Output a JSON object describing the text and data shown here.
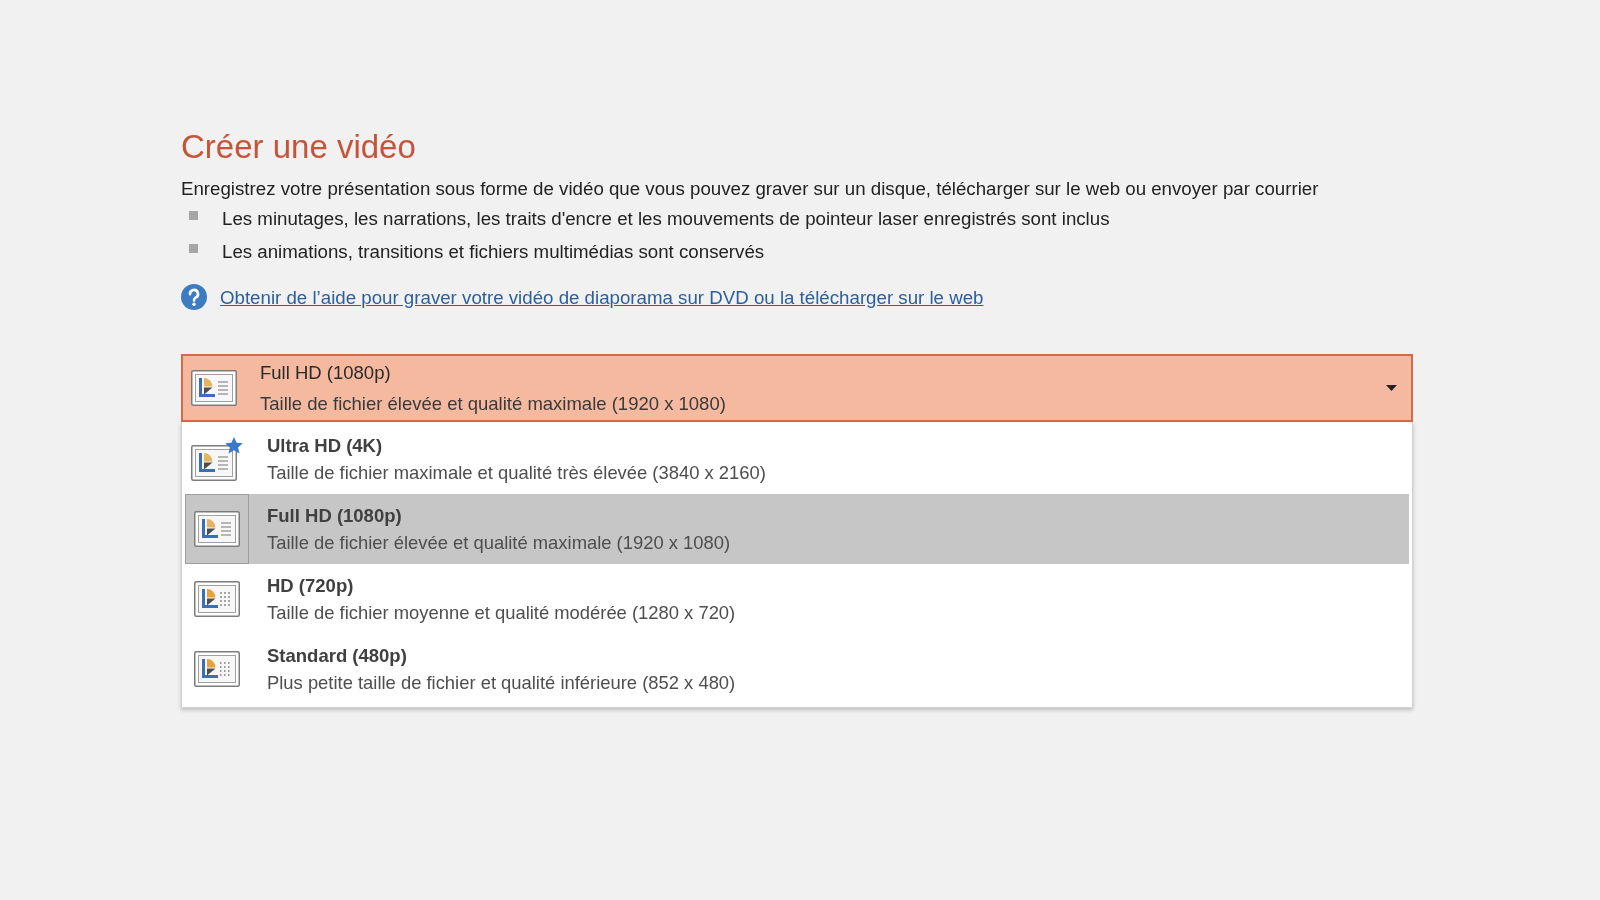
{
  "title": "Créer une vidéo",
  "description": "Enregistrez votre présentation sous forme de vidéo que vous pouvez graver sur un disque, télécharger sur le web ou envoyer par courrier",
  "bullets": [
    "Les minutages, les narrations, les traits d'encre et les mouvements de pointeur laser enregistrés sont inclus",
    "Les animations, transitions et fichiers multimédias sont conservés"
  ],
  "help_link": "Obtenir de l’aide pour graver votre vidéo de diaporama sur DVD ou la télécharger sur le web",
  "quality_dropdown": {
    "expanded": true,
    "value": {
      "kind": "full-hd",
      "title": "Full HD (1080p)",
      "subtitle": "Taille de fichier élevée et qualité maximale (1920 x 1080)"
    },
    "options": [
      {
        "kind": "ultra-hd",
        "title": "Ultra HD (4K)",
        "subtitle": "Taille de fichier maximale et qualité très élevée (3840 x 2160)",
        "selected": false
      },
      {
        "kind": "full-hd",
        "title": "Full HD (1080p)",
        "subtitle": "Taille de fichier élevée et qualité maximale (1920 x 1080)",
        "selected": true
      },
      {
        "kind": "hd",
        "title": "HD (720p)",
        "subtitle": "Taille de fichier moyenne et qualité modérée (1280 x 720)",
        "selected": false
      },
      {
        "kind": "standard",
        "title": "Standard (480p)",
        "subtitle": "Plus petite taille de fichier et qualité inférieure (852 x 480)",
        "selected": false
      }
    ]
  }
}
